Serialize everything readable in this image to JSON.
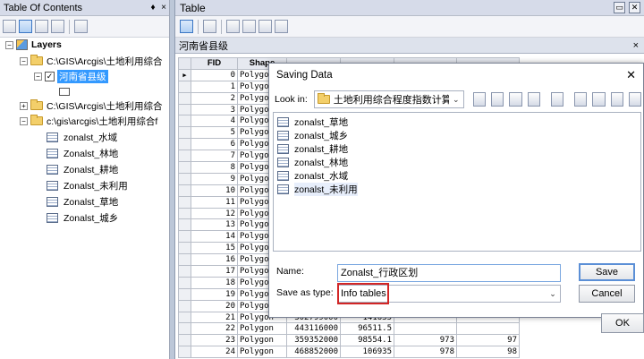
{
  "toc": {
    "title": "Table Of Contents",
    "pin": "♦",
    "close": "×",
    "layers_label": "Layers",
    "folder1": "C:\\GIS\\Arcgis\\土地利用综合",
    "layer_selected": "河南省县级",
    "folder2": "C:\\GIS\\Arcgis\\土地利用综合",
    "folder3": "c:\\gis\\arcgis\\土地利用综合f",
    "tables": [
      "zonalst_水域",
      "Zonalst_林地",
      "Zonalst_耕地",
      "Zonalst_未利用",
      "Zonalst_草地",
      "Zonalst_城乡"
    ]
  },
  "table_window": {
    "title": "Table",
    "tab_name": "河南省县级",
    "tab_close": "×",
    "columns": {
      "fid": "FID",
      "shape": "Shape"
    },
    "rows": [
      {
        "fid": "0",
        "shape": "Polygon"
      },
      {
        "fid": "1",
        "shape": "Polygon"
      },
      {
        "fid": "2",
        "shape": "Polygon"
      },
      {
        "fid": "3",
        "shape": "Polygon"
      },
      {
        "fid": "4",
        "shape": "Polygon"
      },
      {
        "fid": "5",
        "shape": "Polygon"
      },
      {
        "fid": "6",
        "shape": "Polygon"
      },
      {
        "fid": "7",
        "shape": "Polygon"
      },
      {
        "fid": "8",
        "shape": "Polygon"
      },
      {
        "fid": "9",
        "shape": "Polygon"
      },
      {
        "fid": "10",
        "shape": "Polygon"
      },
      {
        "fid": "11",
        "shape": "Polygon"
      },
      {
        "fid": "12",
        "shape": "Polygon"
      },
      {
        "fid": "13",
        "shape": "Polygon"
      },
      {
        "fid": "14",
        "shape": "Polygon"
      },
      {
        "fid": "15",
        "shape": "Polygon"
      },
      {
        "fid": "16",
        "shape": "Polygon"
      },
      {
        "fid": "17",
        "shape": "Polygon"
      },
      {
        "fid": "18",
        "shape": "Polygon"
      },
      {
        "fid": "19",
        "shape": "Polygon"
      },
      {
        "fid": "20",
        "shape": "Polygon"
      },
      {
        "fid": "21",
        "shape": "Polygon",
        "a": "302799000",
        "b": "141635",
        "c": "",
        "d": ""
      },
      {
        "fid": "22",
        "shape": "Polygon",
        "a": "443116000",
        "b": "96511.5",
        "c": "",
        "d": ""
      },
      {
        "fid": "23",
        "shape": "Polygon",
        "a": "359352000",
        "b": "98554.1",
        "c": "973",
        "d": "97"
      },
      {
        "fid": "24",
        "shape": "Polygon",
        "a": "468852000",
        "b": "106935",
        "c": "978",
        "d": "98"
      }
    ]
  },
  "dialog": {
    "title": "Saving Data",
    "close": "✕",
    "look_in_label": "Look in:",
    "look_in_value": "土地利用综合程度指数计算",
    "files": [
      "zonalst_草地",
      "zonalst_城乡",
      "zonalst_耕地",
      "zonalst_林地",
      "zonalst_水域",
      "zonalst_未利用"
    ],
    "name_label": "Name:",
    "name_value": "Zonalst_行政区划",
    "type_label": "Save as type:",
    "type_value": "Info tables",
    "save_button": "Save",
    "cancel_button": "Cancel"
  },
  "ok_button": "OK",
  "accent_colors": {
    "selection": "#3399ff",
    "annotation_box": "#d22626",
    "default_button": "#5b8fd6"
  }
}
